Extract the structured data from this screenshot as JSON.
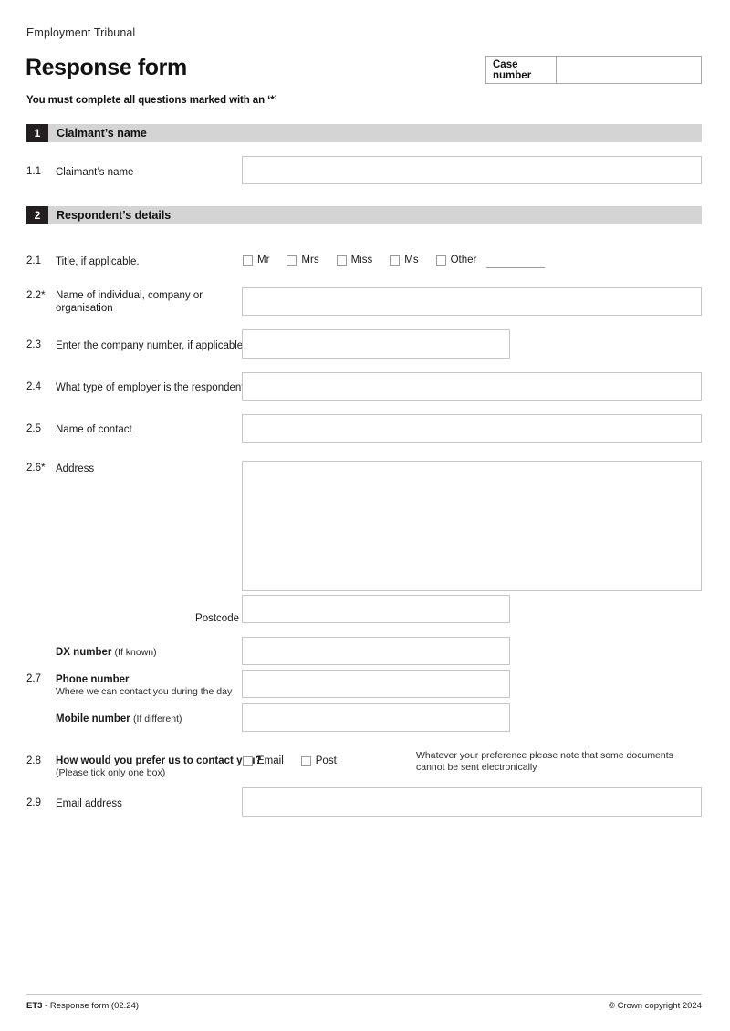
{
  "header": {
    "organisation": "Employment Tribunal",
    "title": "Response form",
    "instruction": "You must complete all questions marked with an ‘*’",
    "case_number_label": "Case number",
    "case_number_value": ""
  },
  "sections": [
    {
      "number": "1",
      "title": "Claimant’s name"
    },
    {
      "number": "2",
      "title": "Respondent’s details"
    }
  ],
  "questions": {
    "q1_1": {
      "number": "1.1",
      "label": "Claimant’s name",
      "value": ""
    },
    "q2_1": {
      "number": "2.1",
      "label": "Title, if applicable.",
      "options": [
        {
          "label": "Mr",
          "checked": false
        },
        {
          "label": "Mrs",
          "checked": false
        },
        {
          "label": "Miss",
          "checked": false
        },
        {
          "label": "Ms",
          "checked": false
        },
        {
          "label": "Other",
          "checked": false
        }
      ],
      "other_value": ""
    },
    "q2_2": {
      "number": "2.2*",
      "label_line1": "Name of individual, company or",
      "label_line2": "organisation",
      "value": ""
    },
    "q2_3": {
      "number": "2.3",
      "label": "Enter the company number, if applicable.",
      "value": ""
    },
    "q2_4": {
      "number": "2.4",
      "label": "What type of employer is the respondent?",
      "value": ""
    },
    "q2_5": {
      "number": "2.5",
      "label": "Name of contact",
      "value": ""
    },
    "q2_6": {
      "number": "2.6*",
      "label": "Address",
      "value": "",
      "postcode_label": "Postcode",
      "postcode_value": "",
      "dx_label_bold": "DX number",
      "dx_label_note": "(If known)",
      "dx_value": ""
    },
    "q2_7": {
      "number": "2.7",
      "label_bold": "Phone number",
      "label_sub": "Where we can contact you during the day",
      "value": "",
      "mobile_label_bold": "Mobile number",
      "mobile_label_note": "(If different)",
      "mobile_value": ""
    },
    "q2_8": {
      "number": "2.8",
      "label_bold": "How would you prefer us to contact you?",
      "label_sub": "(Please tick only one box)",
      "options": [
        {
          "label": "Email",
          "checked": false
        },
        {
          "label": "Post",
          "checked": false
        }
      ],
      "note_line1": "Whatever your preference please note that some documents",
      "note_line2": "cannot be sent electronically"
    },
    "q2_9": {
      "number": "2.9",
      "label": "Email address",
      "value": ""
    }
  },
  "footer": {
    "code": "ET3",
    "text": " - Response form (02.24)",
    "copyright": "© Crown copyright 2024"
  }
}
